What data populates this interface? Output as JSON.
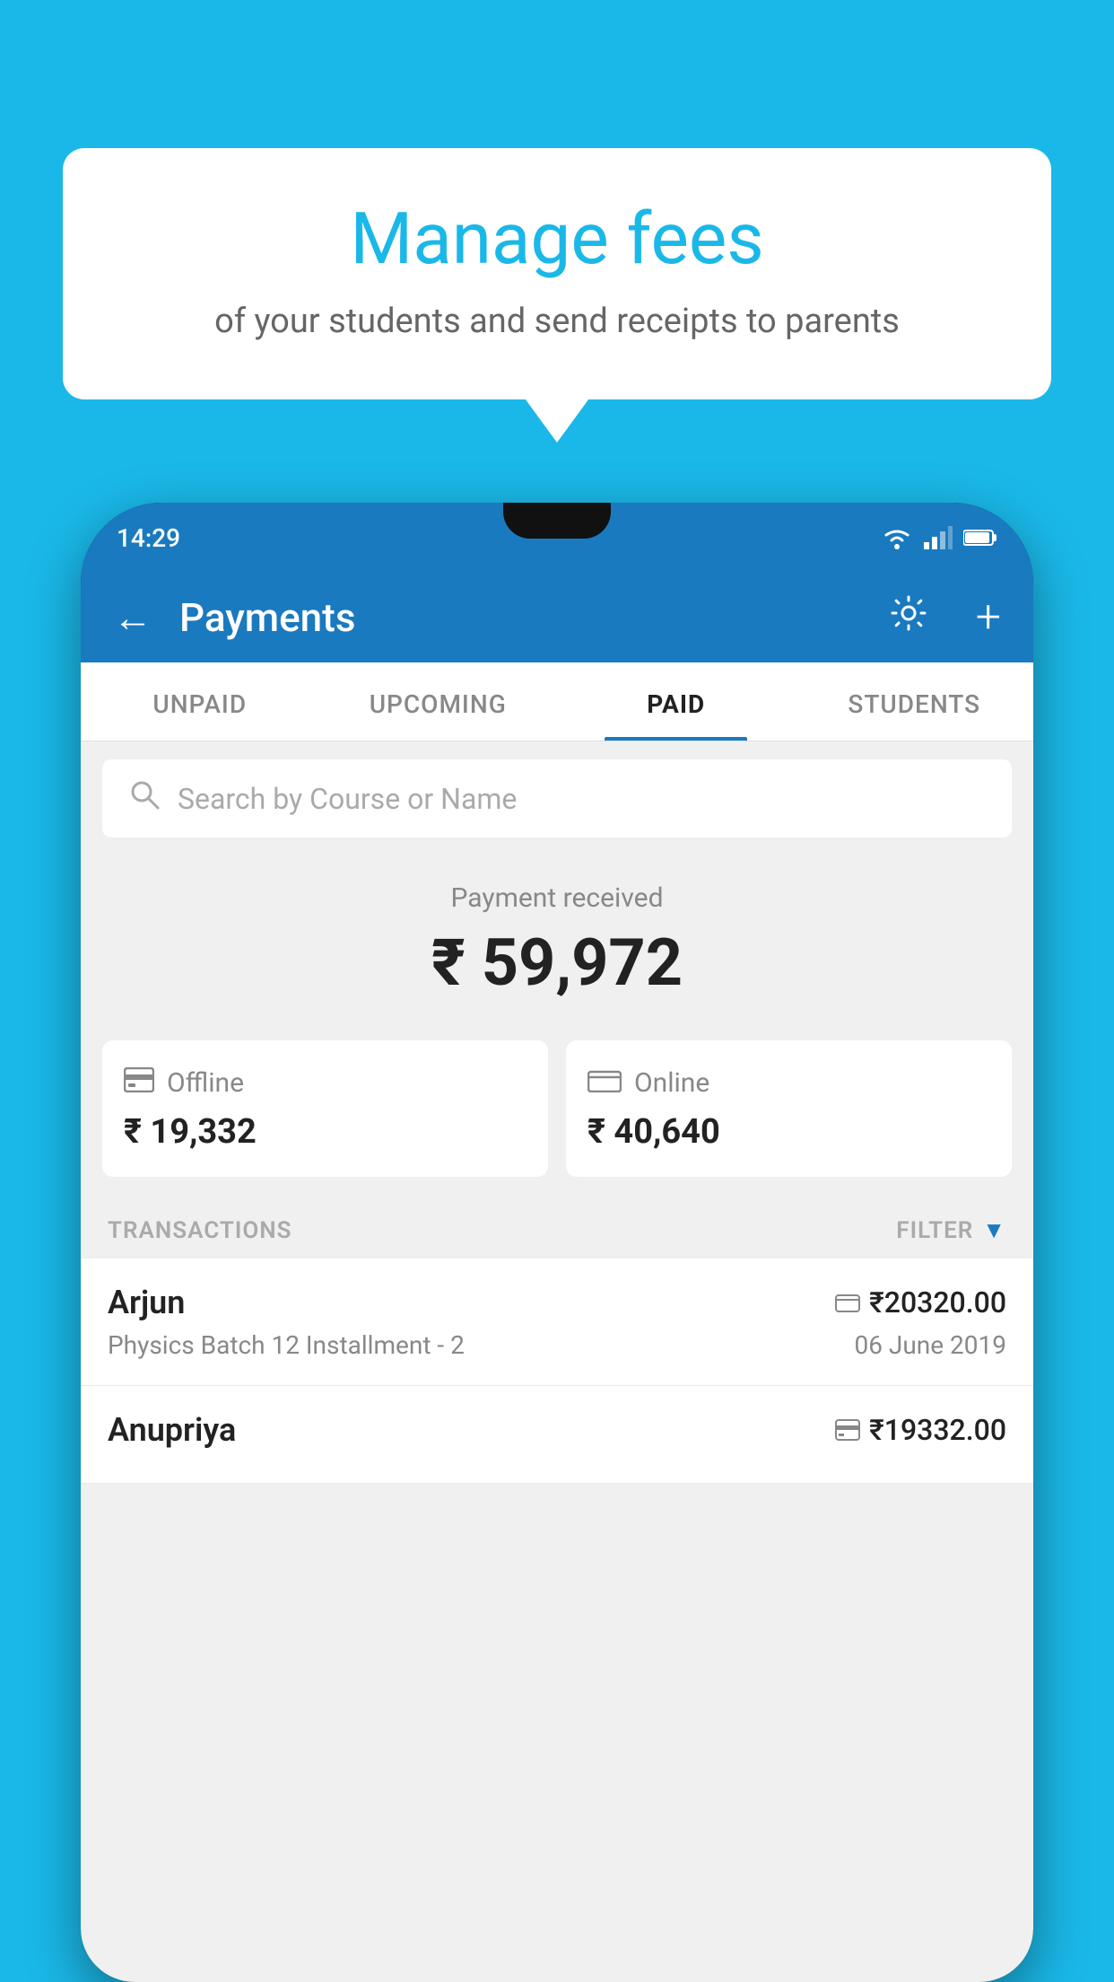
{
  "background_color": "#1ab8e8",
  "bubble": {
    "title": "Manage fees",
    "subtitle": "of your students and send receipts to parents"
  },
  "phone": {
    "status_bar": {
      "time": "14:29"
    },
    "header": {
      "title": "Payments",
      "back_label": "←",
      "plus_label": "+"
    },
    "tabs": [
      {
        "label": "UNPAID",
        "active": false
      },
      {
        "label": "UPCOMING",
        "active": false
      },
      {
        "label": "PAID",
        "active": true
      },
      {
        "label": "STUDENTS",
        "active": false
      }
    ],
    "search": {
      "placeholder": "Search by Course or Name"
    },
    "payment_section": {
      "label": "Payment received",
      "amount": "₹ 59,972",
      "offline_label": "Offline",
      "offline_amount": "₹ 19,332",
      "online_label": "Online",
      "online_amount": "₹ 40,640"
    },
    "transactions": {
      "header_label": "TRANSACTIONS",
      "filter_label": "FILTER",
      "rows": [
        {
          "name": "Arjun",
          "amount": "₹20320.00",
          "detail": "Physics Batch 12 Installment - 2",
          "date": "06 June 2019",
          "payment_type": "online"
        },
        {
          "name": "Anupriya",
          "amount": "₹19332.00",
          "detail": "",
          "date": "",
          "payment_type": "offline"
        }
      ]
    }
  }
}
